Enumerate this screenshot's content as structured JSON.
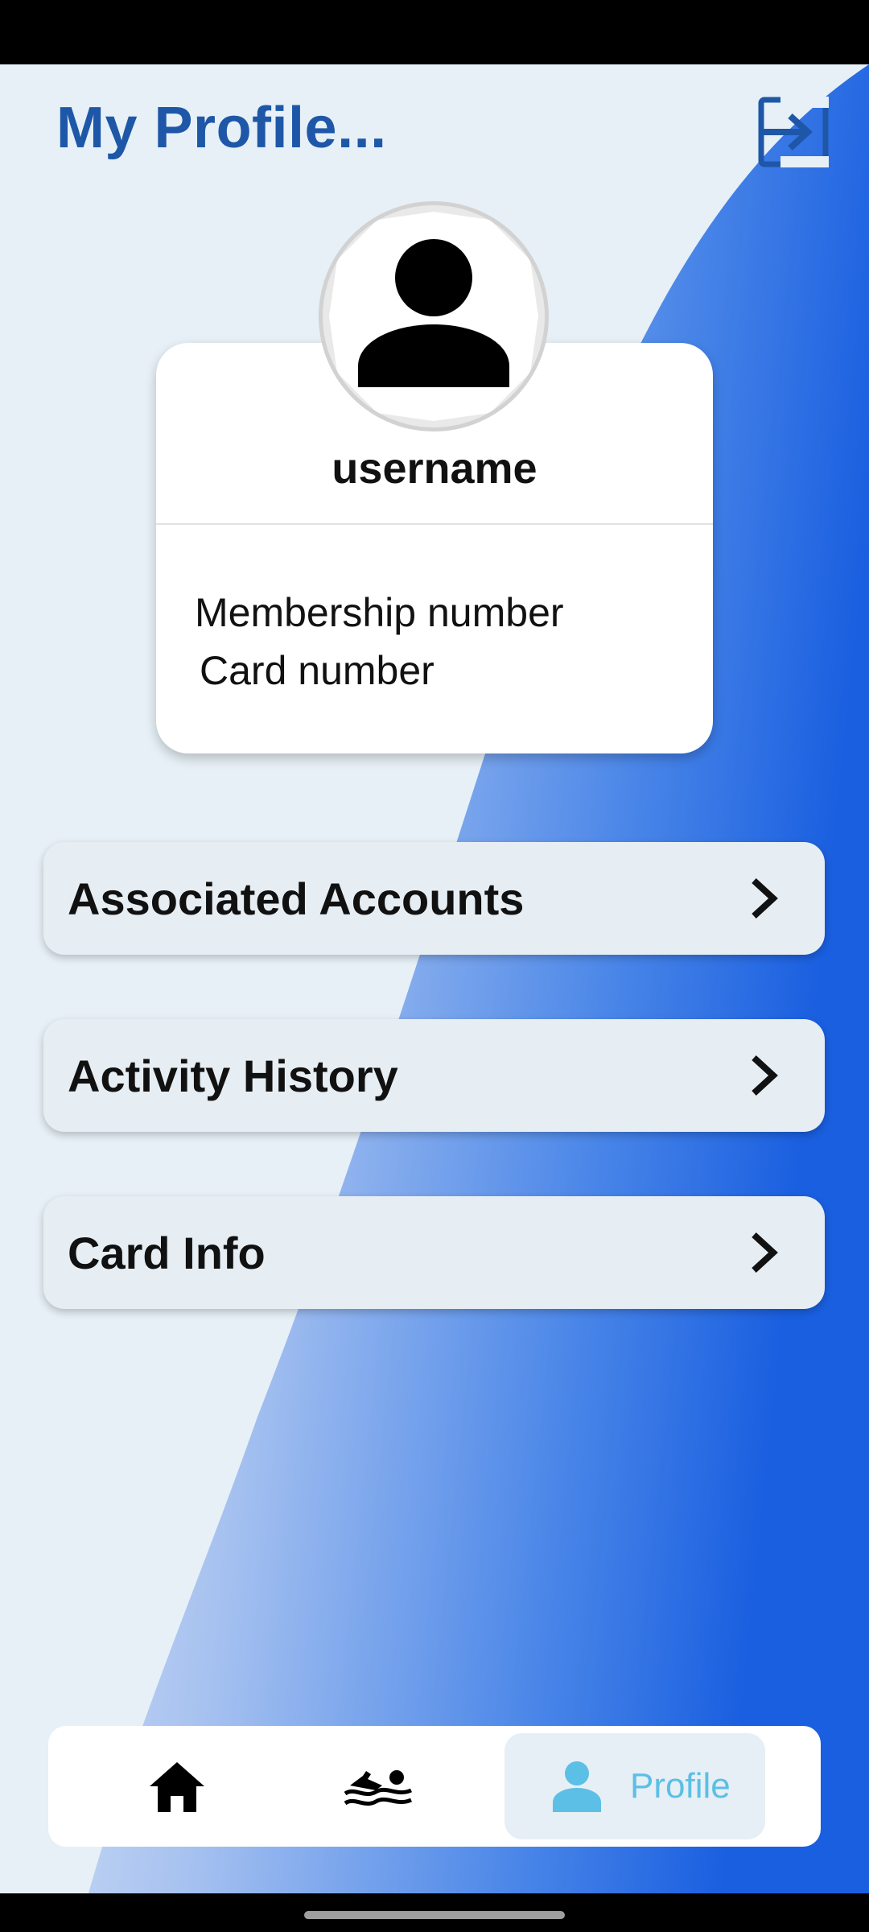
{
  "header": {
    "title": "My Profile...",
    "logout_icon": "logout-icon"
  },
  "profile": {
    "username": "username",
    "membership_label": "Membership number",
    "card_label": "Card number",
    "avatar_icon": "person-icon"
  },
  "menu": {
    "items": [
      {
        "label": "Associated Accounts",
        "icon": "chevron-right-icon"
      },
      {
        "label": "Activity History",
        "icon": "chevron-right-icon"
      },
      {
        "label": "Card Info",
        "icon": "chevron-right-icon"
      }
    ]
  },
  "bottom_nav": {
    "items": [
      {
        "icon": "home-icon"
      },
      {
        "icon": "swimmer-icon"
      },
      {
        "icon": "person-icon",
        "label": "Profile",
        "active": true
      }
    ]
  },
  "colors": {
    "accent": "#1e57a8",
    "background": "#e6f0f6",
    "gradient_dark": "#1a5fe0",
    "active_tab": "#5bbfe6"
  }
}
